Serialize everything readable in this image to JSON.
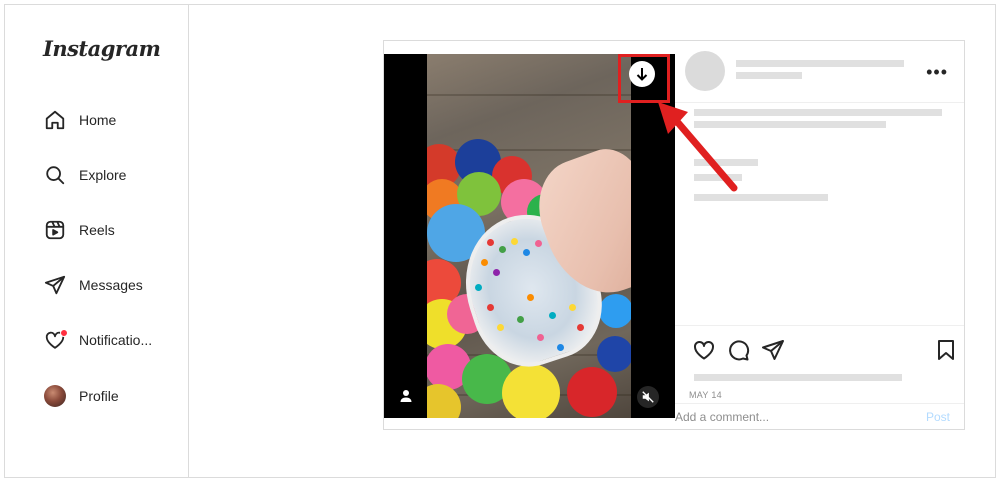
{
  "app": {
    "logo": "Instagram"
  },
  "sidebar": {
    "items": [
      {
        "label": "Home",
        "icon": "home-icon"
      },
      {
        "label": "Explore",
        "icon": "search-icon"
      },
      {
        "label": "Reels",
        "icon": "reels-icon"
      },
      {
        "label": "Messages",
        "icon": "send-icon"
      },
      {
        "label": "Notificatio...",
        "icon": "heart-icon",
        "has_badge": true
      },
      {
        "label": "Profile",
        "icon": "avatar"
      }
    ]
  },
  "post": {
    "date": "MAY 14",
    "comment_placeholder": "Add a comment...",
    "post_label": "Post",
    "annotation_color": "#e02020"
  },
  "colors": {
    "accent": "#0095f6",
    "post_disabled": "#b3dbff",
    "badge": "#ff3040",
    "border": "#dbdbdb"
  }
}
